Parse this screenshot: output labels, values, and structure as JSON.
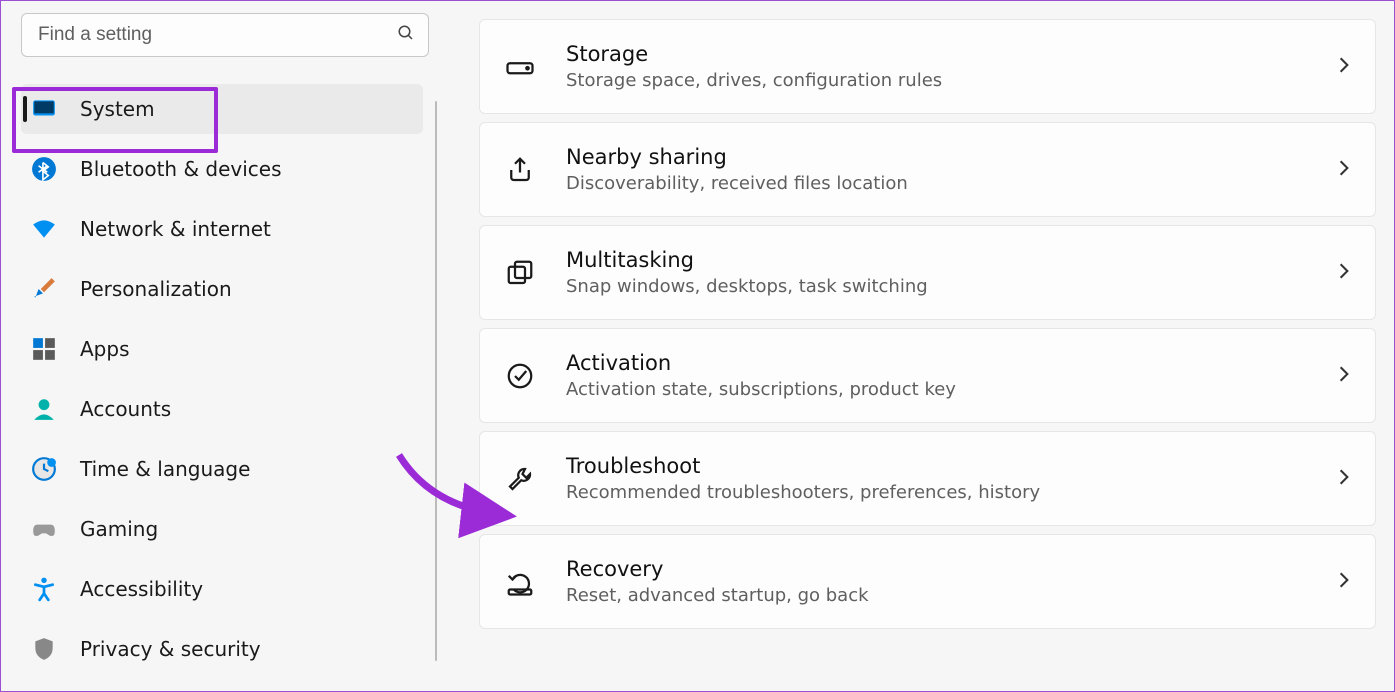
{
  "search": {
    "placeholder": "Find a setting"
  },
  "sidebar": {
    "items": [
      {
        "label": "System",
        "icon": "display"
      },
      {
        "label": "Bluetooth & devices",
        "icon": "bluetooth"
      },
      {
        "label": "Network & internet",
        "icon": "wifi"
      },
      {
        "label": "Personalization",
        "icon": "brush"
      },
      {
        "label": "Apps",
        "icon": "apps"
      },
      {
        "label": "Accounts",
        "icon": "account"
      },
      {
        "label": "Time & language",
        "icon": "clock"
      },
      {
        "label": "Gaming",
        "icon": "gamepad"
      },
      {
        "label": "Accessibility",
        "icon": "accessibility"
      },
      {
        "label": "Privacy & security",
        "icon": "shield"
      }
    ]
  },
  "cards": [
    {
      "title": "Storage",
      "subtitle": "Storage space, drives, configuration rules",
      "icon": "storage"
    },
    {
      "title": "Nearby sharing",
      "subtitle": "Discoverability, received files location",
      "icon": "share"
    },
    {
      "title": "Multitasking",
      "subtitle": "Snap windows, desktops, task switching",
      "icon": "windows"
    },
    {
      "title": "Activation",
      "subtitle": "Activation state, subscriptions, product key",
      "icon": "check"
    },
    {
      "title": "Troubleshoot",
      "subtitle": "Recommended troubleshooters, preferences, history",
      "icon": "wrench"
    },
    {
      "title": "Recovery",
      "subtitle": "Reset, advanced startup, go back",
      "icon": "recovery"
    }
  ]
}
